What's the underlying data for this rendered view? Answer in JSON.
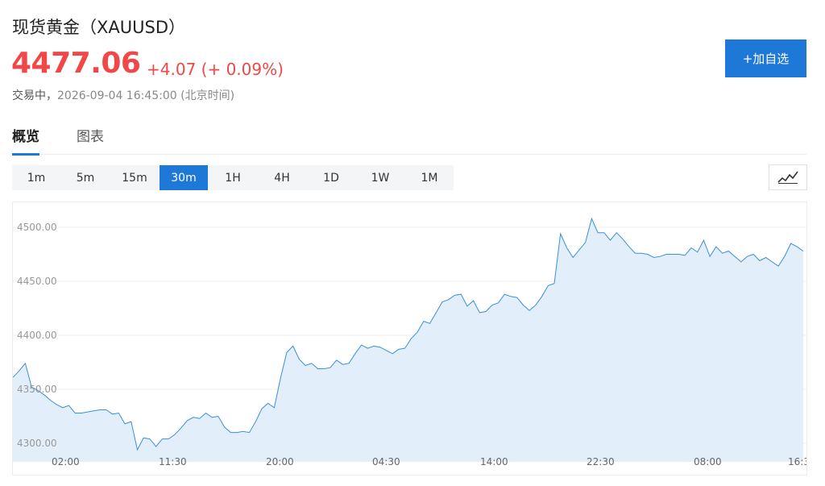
{
  "header": {
    "title": "现货黄金（XAUUSD）",
    "price": "4477.06",
    "change": "+4.07 (+ 0.09%)",
    "status": "交易中，",
    "timestamp": "2026-09-04 16:45:00 (北京时间)",
    "add_button": "+加自选"
  },
  "tabs": [
    {
      "label": "概览",
      "active": true
    },
    {
      "label": "图表",
      "active": false
    }
  ],
  "intervals": [
    "1m",
    "5m",
    "15m",
    "30m",
    "1H",
    "4H",
    "1D",
    "1W",
    "1M"
  ],
  "active_interval": "30m",
  "chart_type_icon": "line-chart-icon",
  "colors": {
    "up": "#f04848",
    "accent": "#1e78d8",
    "line": "#3a8fd9",
    "area": "#e2effb"
  },
  "chart_data": {
    "type": "area",
    "ylim": [
      4290,
      4510
    ],
    "y_ticks": [
      "4500.00",
      "4450.00",
      "4400.00",
      "4350.00",
      "4300.00"
    ],
    "x_ticks": [
      "02:00",
      "11:30",
      "20:00",
      "04:30",
      "14:00",
      "22:30",
      "08:00",
      "16:3"
    ],
    "values": [
      4361,
      4367,
      4374,
      4352,
      4349,
      4345,
      4340,
      4336,
      4333,
      4335,
      4328,
      4328,
      4329,
      4330,
      4331,
      4331,
      4327,
      4328,
      4318,
      4320,
      4294,
      4305,
      4304,
      4297,
      4304,
      4304,
      4308,
      4314,
      4321,
      4324,
      4323,
      4328,
      4324,
      4325,
      4315,
      4310,
      4310,
      4311,
      4310,
      4320,
      4332,
      4337,
      4333,
      4360,
      4384,
      4390,
      4378,
      4372,
      4374,
      4369,
      4369,
      4370,
      4377,
      4373,
      4374,
      4383,
      4391,
      4388,
      4390,
      4389,
      4386,
      4383,
      4387,
      4388,
      4397,
      4403,
      4413,
      4411,
      4421,
      4431,
      4433,
      4437,
      4438,
      4427,
      4432,
      4421,
      4422,
      4428,
      4430,
      4438,
      4436,
      4435,
      4428,
      4423,
      4428,
      4436,
      4446,
      4448,
      4494,
      4481,
      4472,
      4479,
      4486,
      4508,
      4495,
      4495,
      4488,
      4495,
      4489,
      4482,
      4476,
      4476,
      4475,
      4472,
      4473,
      4475,
      4475,
      4475,
      4474,
      4481,
      4477,
      4488,
      4473,
      4482,
      4476,
      4478,
      4473,
      4468,
      4473,
      4475,
      4469,
      4472,
      4468,
      4464,
      4473,
      4485,
      4482,
      4478
    ]
  }
}
